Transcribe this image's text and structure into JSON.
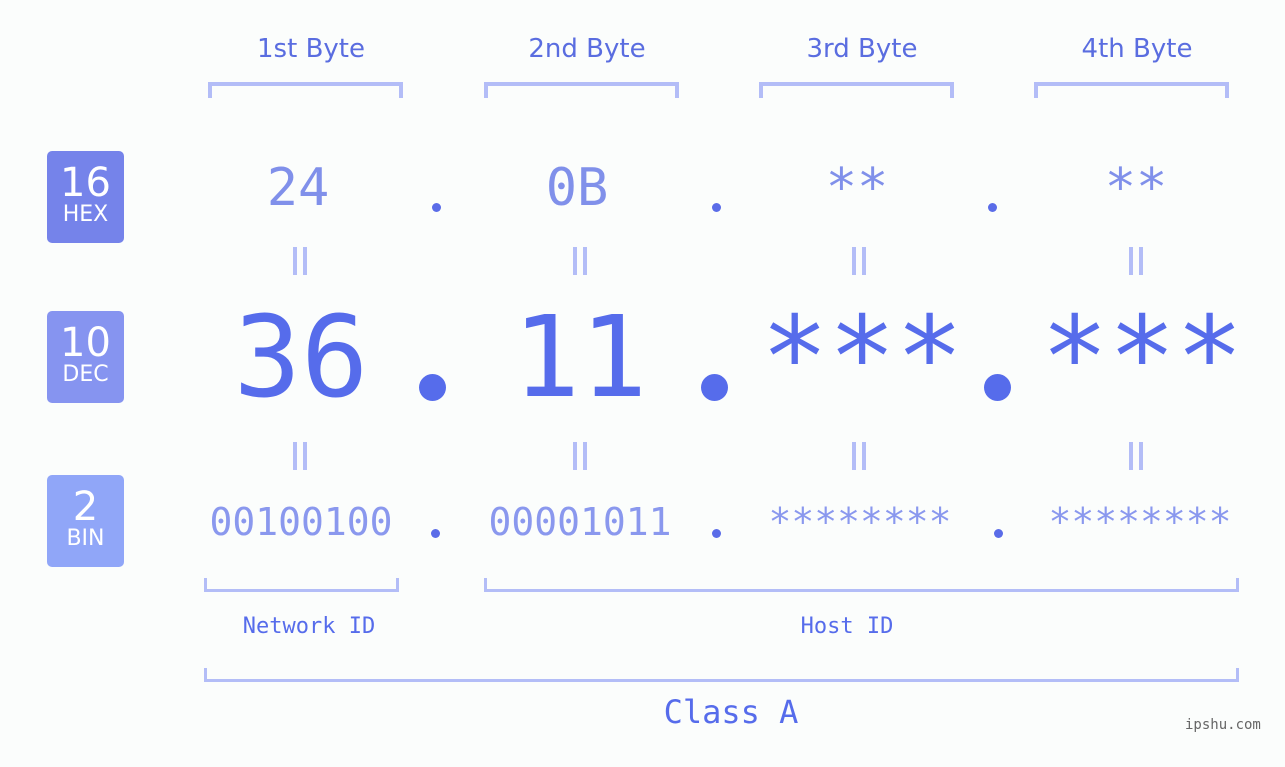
{
  "bytes": [
    {
      "label": "1st Byte",
      "hex": "24",
      "dec": "36",
      "bin": "00100100"
    },
    {
      "label": "2nd Byte",
      "hex": "0B",
      "dec": "11",
      "bin": "00001011"
    },
    {
      "label": "3rd Byte",
      "hex": "**",
      "dec": "***",
      "bin": "********"
    },
    {
      "label": "4th Byte",
      "hex": "**",
      "dec": "***",
      "bin": "********"
    }
  ],
  "badges": {
    "hex": {
      "num": "16",
      "label": "HEX",
      "color": "#7583ea"
    },
    "dec": {
      "num": "10",
      "label": "DEC",
      "color": "#8694f0"
    },
    "bin": {
      "num": "2",
      "label": "BIN",
      "color": "#90a6f8"
    }
  },
  "segments": {
    "network": "Network ID",
    "host": "Host ID"
  },
  "class_label": "Class A",
  "watermark": "ipshu.com",
  "colors": {
    "accent": "#566ceb",
    "light": "#b3bdf7",
    "hex_text": "#8090ea",
    "bin_text": "#8a98ee"
  }
}
